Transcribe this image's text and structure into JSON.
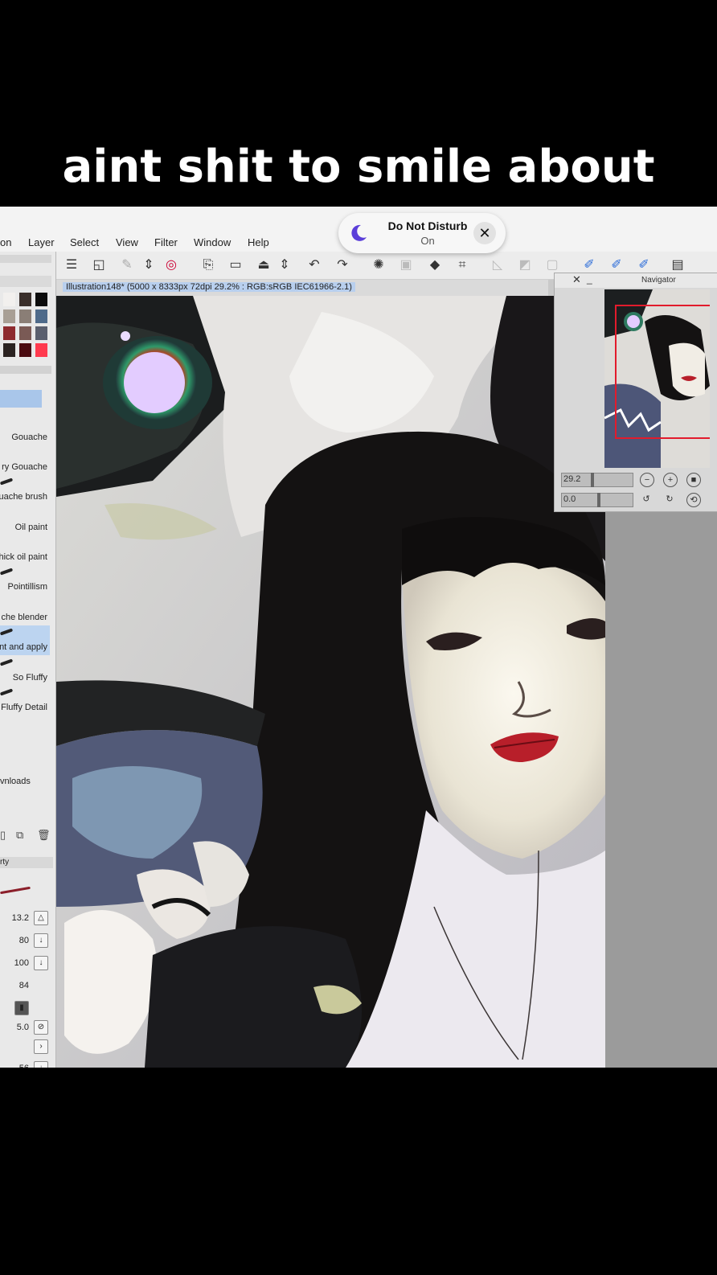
{
  "caption": "aint shit to smile about",
  "menu": [
    "on",
    "Layer",
    "Select",
    "View",
    "Filter",
    "Window",
    "Help"
  ],
  "dnd": {
    "title": "Do Not Disturb",
    "status": "On"
  },
  "document_title": "Illustration148* (5000 x 8333px 72dpi 29.2% : RGB:sRGB IEC61966-2.1)",
  "brushes": [
    "Gouache",
    "ry Gouache",
    "uache brush",
    "Oil paint",
    "hick oil paint",
    "Pointillism",
    "che blender",
    "nt and apply",
    "So Fluffy",
    "Fluffy Detail"
  ],
  "selected_brush": "nt and apply",
  "downloads_label": "vnloads",
  "property_label": "rty",
  "properties": [
    "13.2",
    "80",
    "100",
    "84",
    "",
    "5.0",
    "",
    "56"
  ],
  "navigator": {
    "title": "Navigator",
    "zoom": "29.2",
    "rotation": "0.0"
  },
  "accent": "#2a6bd8"
}
